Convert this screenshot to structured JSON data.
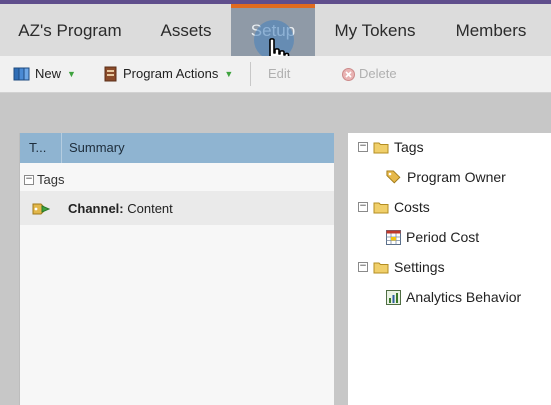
{
  "tabs": [
    {
      "label": "AZ's Program"
    },
    {
      "label": "Assets"
    },
    {
      "label": "Setup"
    },
    {
      "label": "My Tokens"
    },
    {
      "label": "Members"
    }
  ],
  "active_tab": "Setup",
  "toolbar": {
    "new_label": "New",
    "program_actions_label": "Program Actions",
    "edit_label": "Edit",
    "delete_label": "Delete"
  },
  "grid": {
    "columns": [
      "T...",
      "Summary"
    ],
    "group_label": "Tags",
    "rows": [
      {
        "key": "Channel:",
        "value": " Content"
      }
    ]
  },
  "tree": {
    "nodes": [
      {
        "label": "Tags",
        "children": [
          {
            "label": "Program Owner",
            "icon": "tag-icon"
          }
        ]
      },
      {
        "label": "Costs",
        "children": [
          {
            "label": "Period Cost",
            "icon": "calendar-grid-icon"
          }
        ]
      },
      {
        "label": "Settings",
        "children": [
          {
            "label": "Analytics Behavior",
            "icon": "analytics-icon"
          }
        ]
      }
    ]
  },
  "colors": {
    "accent_top": "#5f4e8c",
    "active_tab_bg": "#8f9aa7",
    "active_tab_marker": "#e06b1f",
    "grid_header": "#8fb4d1"
  }
}
